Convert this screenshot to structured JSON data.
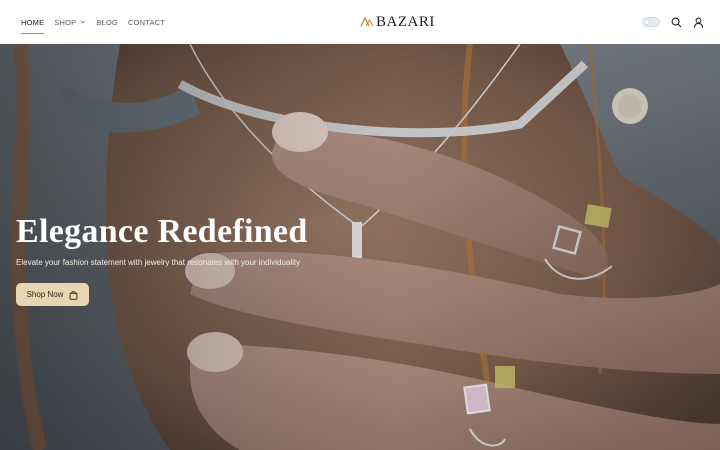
{
  "nav": {
    "items": [
      {
        "label": "HOME",
        "active": true
      },
      {
        "label": "SHOP",
        "has_dropdown": true
      },
      {
        "label": "BLOG"
      },
      {
        "label": "CONTACT"
      }
    ]
  },
  "brand": {
    "name": "BAZARI",
    "mark_color": "#c0862f"
  },
  "header_actions": {
    "theme_toggle": "toggle-icon",
    "search": "search-icon",
    "account": "user-icon"
  },
  "hero": {
    "title": "Elegance Redefined",
    "subtitle": "Elevate your fashion statement with jewelry that resonates with your individuality",
    "cta_label": "Shop Now",
    "cta_icon": "bag-icon",
    "cta_color": "#e8d6b2"
  }
}
